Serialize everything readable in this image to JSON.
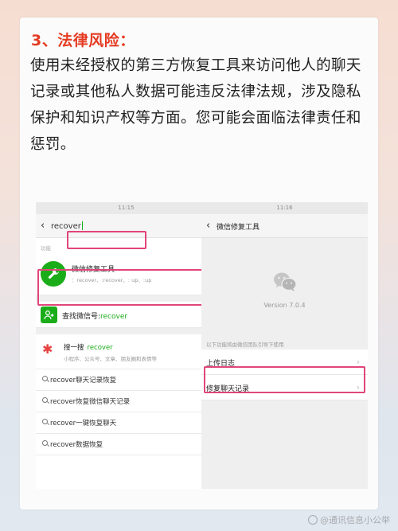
{
  "article": {
    "heading": "3、法律风险：",
    "paragraph": "使用未经授权的第三方恢复工具来访问他人的聊天记录或其他私人数据可能违反法律法规，涉及隐私保护和知识产权等方面。您可能会面临法律责任和惩罚。"
  },
  "left_phone": {
    "time": "11:15",
    "search_value": "recover",
    "section_label": "功能",
    "app_result": {
      "title": "微信修复工具",
      "subtitle": "：recover、:recover、: up、:up"
    },
    "wechat_id": {
      "prefix": "查找微信号:",
      "query": "recover"
    },
    "sousou": {
      "label": "搜一搜",
      "query": "recover",
      "subtitle": "小程序、公众号、文章、朋友圈和表情等"
    },
    "suggestions": [
      "recover聊天记录恢复",
      "recover恢复微信聊天记录",
      "recover一键恢复聊天",
      "recover数据恢复"
    ]
  },
  "right_phone": {
    "time": "11:16",
    "title": "微信修复工具",
    "version": "Version 7.0.4",
    "notice": "以下功能将由微信团队引导下使用",
    "menu": [
      {
        "label": "上传日志"
      },
      {
        "label": "修复聊天记录"
      }
    ]
  },
  "watermark": "@通讯信息小公举"
}
